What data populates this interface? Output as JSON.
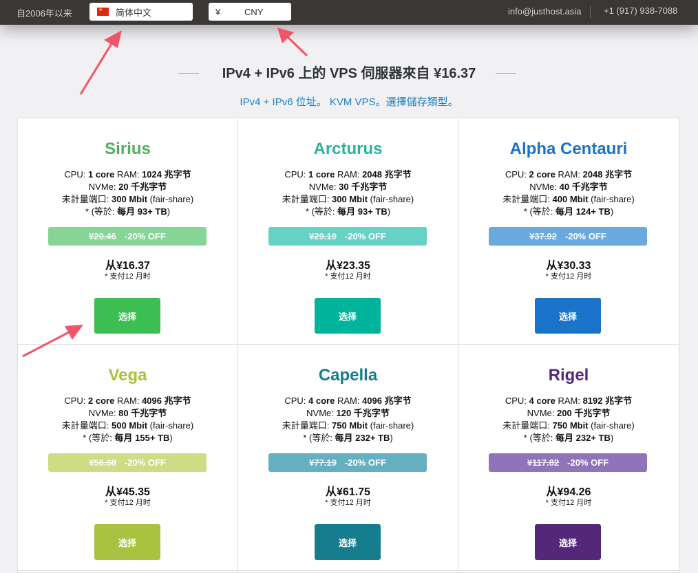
{
  "topbar": {
    "since": "自2006年以来",
    "language": "简体中文",
    "currency_symbol": "¥",
    "currency": "CNY",
    "email": "info@justhost.asia",
    "phone": "+1 (917) 938-7088"
  },
  "heading": "IPv4 + IPv6 上的 VPS 伺服器來自 ¥16.37",
  "subheading": "IPv4 + IPv6 位址。 KVM VPS。選擇儲存類型。",
  "labels": {
    "cpu": "CPU: ",
    "ram": " RAM: ",
    "nvme": "NVMe: ",
    "port": "未計量端口: ",
    "fair": " (fair-share)",
    "equiv_prefix": "* (等於: ",
    "equiv_suffix": ")",
    "period": "*  支付12 月时",
    "select": "选择"
  },
  "colors": {
    "sirius": "#4cb260",
    "arcturus": "#2ab3a0",
    "alpha": "#1a73c2",
    "vega": "#a9c23f",
    "capella": "#157d8e",
    "rigel": "#53287a"
  },
  "plans": [
    {
      "name": "Sirius",
      "cpu": "1 core",
      "ram": "1024 兆字节",
      "nvme": "20 千兆字节",
      "port": "300 Mbit",
      "traffic": "每月 93+ TB",
      "old_price": "¥20.46",
      "discount": "-20% OFF",
      "price": "从¥16.37",
      "name_color": "#4cb260",
      "bar_color": "#86d597",
      "btn_color": "#3cbe53"
    },
    {
      "name": "Arcturus",
      "cpu": "1 core",
      "ram": "2048 兆字节",
      "nvme": "30 千兆字节",
      "port": "300 Mbit",
      "traffic": "每月 93+ TB",
      "old_price": "¥29.19",
      "discount": "-20% OFF",
      "price": "从¥23.35",
      "name_color": "#2ab3a0",
      "bar_color": "#66d2c4",
      "btn_color": "#00b39b"
    },
    {
      "name": "Alpha Centauri",
      "cpu": "2 core",
      "ram": "2048 兆字节",
      "nvme": "40 千兆字节",
      "port": "400 Mbit",
      "traffic": "每月 124+ TB",
      "old_price": "¥37.92",
      "discount": "-20% OFF",
      "price": "从¥30.33",
      "name_color": "#1a73c2",
      "bar_color": "#6aa9de",
      "btn_color": "#1a73c8"
    },
    {
      "name": "Vega",
      "cpu": "2 core",
      "ram": "4096 兆字节",
      "nvme": "80 千兆字节",
      "port": "500 Mbit",
      "traffic": "每月 155+ TB",
      "old_price": "¥56.68",
      "discount": "-20% OFF",
      "price": "从¥45.35",
      "name_color": "#a9c23f",
      "bar_color": "#cedc86",
      "btn_color": "#a9c23f"
    },
    {
      "name": "Capella",
      "cpu": "4 core",
      "ram": "4096 兆字节",
      "nvme": "120 千兆字节",
      "port": "750 Mbit",
      "traffic": "每月 232+ TB",
      "old_price": "¥77.19",
      "discount": "-20% OFF",
      "price": "从¥61.75",
      "name_color": "#157d8e",
      "bar_color": "#64b0c1",
      "btn_color": "#157d8e"
    },
    {
      "name": "Rigel",
      "cpu": "4 core",
      "ram": "8192 兆字节",
      "nvme": "200 千兆字节",
      "port": "750 Mbit",
      "traffic": "每月 232+ TB",
      "old_price": "¥117.82",
      "discount": "-20% OFF",
      "price": "从¥94.26",
      "name_color": "#53287a",
      "bar_color": "#9073b8",
      "btn_color": "#53287a"
    }
  ]
}
